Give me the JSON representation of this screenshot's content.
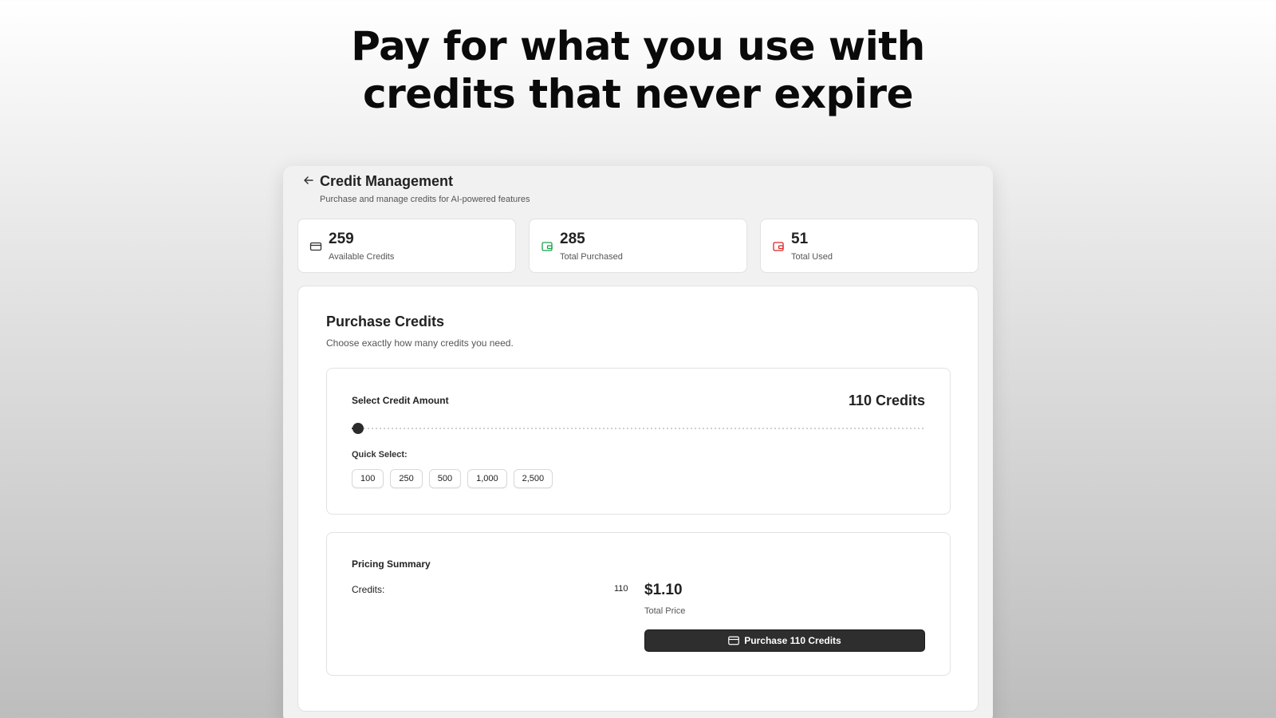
{
  "hero": {
    "line1": "Pay for what you use with",
    "line2": "credits that never expire"
  },
  "page": {
    "title": "Credit Management",
    "subtitle": "Purchase and manage credits for AI-powered features"
  },
  "stats": [
    {
      "value": "259",
      "label": "Available Credits",
      "icon": "credit-card-icon",
      "color": "#333333"
    },
    {
      "value": "285",
      "label": "Total Purchased",
      "icon": "wallet-icon",
      "color": "#16a34a"
    },
    {
      "value": "51",
      "label": "Total Used",
      "icon": "wallet-icon",
      "color": "#dc2626"
    }
  ],
  "purchase": {
    "title": "Purchase Credits",
    "subtitle": "Choose exactly how many credits you need.",
    "select_label": "Select Credit Amount",
    "selected_display": "110 Credits",
    "slider": {
      "min": 100,
      "max": 10000,
      "value": 110
    },
    "quick_select_label": "Quick Select:",
    "quick_select": [
      "100",
      "250",
      "500",
      "1,000",
      "2,500"
    ]
  },
  "pricing": {
    "title": "Pricing Summary",
    "credits_label": "Credits:",
    "credits_value": "110",
    "price": "$1.10",
    "price_label": "Total Price",
    "button_label": "Purchase 110 Credits"
  },
  "colors": {
    "accent": "#2e2e2e",
    "purchased_icon": "#16a34a",
    "used_icon": "#dc2626"
  }
}
